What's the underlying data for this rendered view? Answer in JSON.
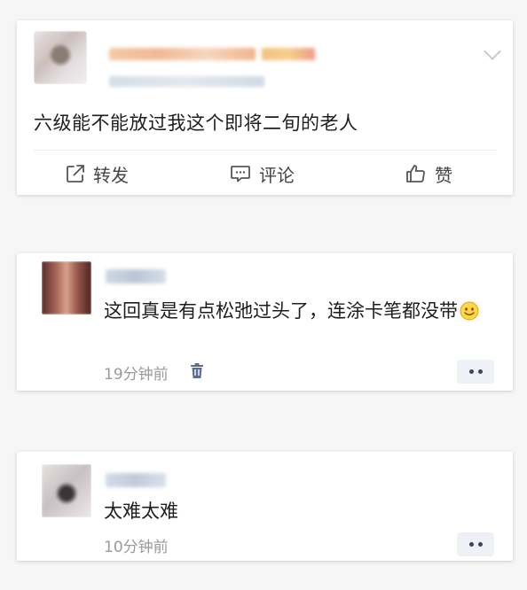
{
  "post": {
    "text": "六级能不能放过我这个即将二旬的老人",
    "actions": {
      "forward": "转发",
      "comment": "评论",
      "like": "赞"
    }
  },
  "comments": [
    {
      "text": "这回真是有点松弛过头了，连涂卡笔都没带",
      "emoji": "smiley-face-icon",
      "time": "19分钟前",
      "has_delete": true
    },
    {
      "text": "太难太难",
      "time": "10分钟前",
      "has_delete": false
    }
  ],
  "colors": {
    "card_bg": "#ffffff",
    "page_bg": "#f6f6f6",
    "more_button_bg": "#eef1f5",
    "more_button_dots": "#3a4660",
    "trash_icon": "#5d6e8c",
    "timestamp": "#9a9a9a"
  }
}
